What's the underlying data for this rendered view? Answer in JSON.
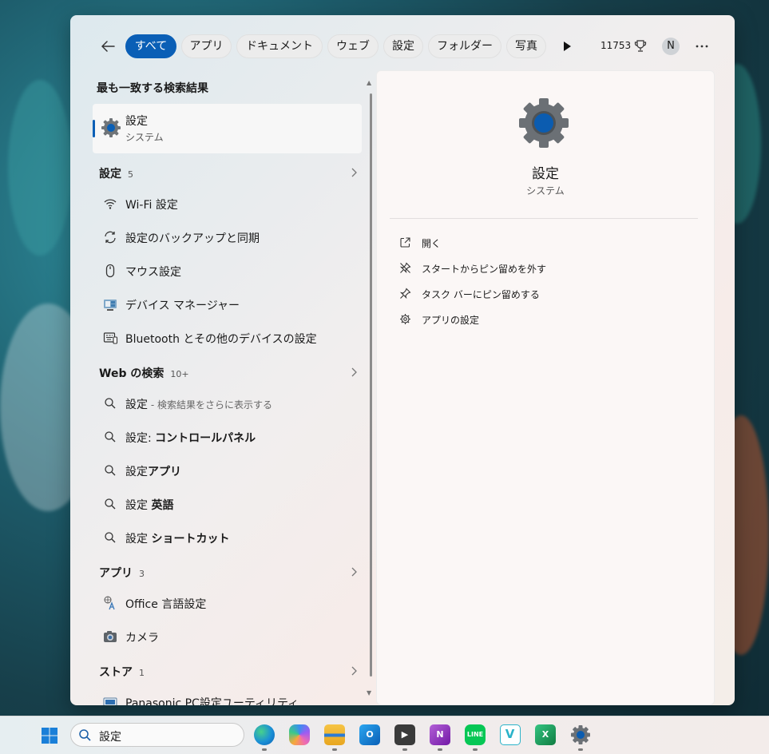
{
  "filter_bar": {
    "chips": [
      {
        "label": "すべて",
        "active": true
      },
      {
        "label": "アプリ",
        "active": false
      },
      {
        "label": "ドキュメント",
        "active": false
      },
      {
        "label": "ウェブ",
        "active": false
      },
      {
        "label": "設定",
        "active": false
      },
      {
        "label": "フォルダー",
        "active": false
      },
      {
        "label": "写真",
        "active": false
      }
    ],
    "points": "11753",
    "avatar_initial": "N"
  },
  "best_match": {
    "section_title": "最も一致する検索結果",
    "title": "設定",
    "subtitle": "システム"
  },
  "groups": {
    "settings": {
      "name": "設定",
      "count": "5"
    },
    "web": {
      "name": "Web の検索",
      "count": "10+"
    },
    "apps": {
      "name": "アプリ",
      "count": "3"
    },
    "store": {
      "name": "ストア",
      "count": "1"
    }
  },
  "settings_items": [
    {
      "label": "Wi-Fi 設定",
      "icon": "wifi-icon"
    },
    {
      "label": "設定のバックアップと同期",
      "icon": "sync-icon"
    },
    {
      "label": "マウス設定",
      "icon": "mouse-icon"
    },
    {
      "label": "デバイス マネージャー",
      "icon": "device-manager-icon"
    },
    {
      "label": "Bluetooth とその他のデバイスの設定",
      "icon": "bluetooth-devices-icon"
    }
  ],
  "web_items": [
    {
      "prefix": "設定",
      "bold": "",
      "muted": " - 検索結果をさらに表示する"
    },
    {
      "prefix": "設定: ",
      "bold": "コントロールパネル",
      "muted": ""
    },
    {
      "prefix": "設定",
      "bold": "アプリ",
      "muted": ""
    },
    {
      "prefix": "設定 ",
      "bold": "英語",
      "muted": ""
    },
    {
      "prefix": "設定 ",
      "bold": "ショートカット",
      "muted": ""
    }
  ],
  "app_items": [
    {
      "label": "Office 言語設定",
      "icon": "office-language-icon"
    },
    {
      "label": "カメラ",
      "icon": "camera-icon"
    }
  ],
  "store_items": [
    {
      "label": "Panasonic PC設定ユーティリティ",
      "icon": "panasonic-icon"
    }
  ],
  "preview": {
    "title": "設定",
    "subtitle": "システム",
    "actions": [
      {
        "label": "開く",
        "icon": "open-external-icon"
      },
      {
        "label": "スタートからピン留めを外す",
        "icon": "unpin-icon"
      },
      {
        "label": "タスク バーにピン留めする",
        "icon": "pin-icon"
      },
      {
        "label": "アプリの設定",
        "icon": "gear-icon"
      }
    ]
  },
  "taskbar": {
    "search_text": "設定",
    "apps": [
      "Edge",
      "Copilot",
      "エクスプローラー",
      "Outlook",
      "メディア",
      "OneNote",
      "LINE",
      "V",
      "Excel",
      "設定"
    ]
  },
  "colors": {
    "accent": "#0a5fb6"
  }
}
